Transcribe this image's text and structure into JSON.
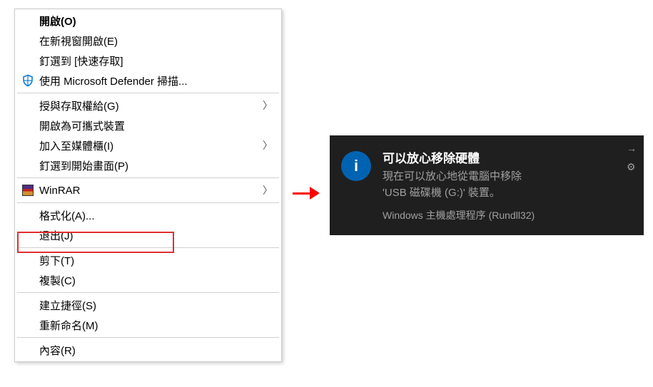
{
  "menu": {
    "open": "開啟(O)",
    "open_new_window": "在新視窗開啟(E)",
    "pin_quick_access": "釘選到 [快速存取]",
    "defender_scan": "使用 Microsoft Defender 掃描...",
    "grant_access": "授與存取權給(G)",
    "open_portable": "開啟為可攜式裝置",
    "add_to_library": "加入至媒體櫃(I)",
    "pin_start": "釘選到開始畫面(P)",
    "winrar": "WinRAR",
    "format": "格式化(A)...",
    "eject": "退出(J)",
    "cut": "剪下(T)",
    "copy": "複製(C)",
    "create_shortcut": "建立捷徑(S)",
    "rename": "重新命名(M)",
    "properties": "內容(R)"
  },
  "toast": {
    "title": "可以放心移除硬體",
    "body_line1": "現在可以放心地從電腦中移除",
    "body_line2": "'USB 磁碟機 (G:)' 裝置。",
    "source": "Windows 主機處理程序 (Rundll32)"
  }
}
